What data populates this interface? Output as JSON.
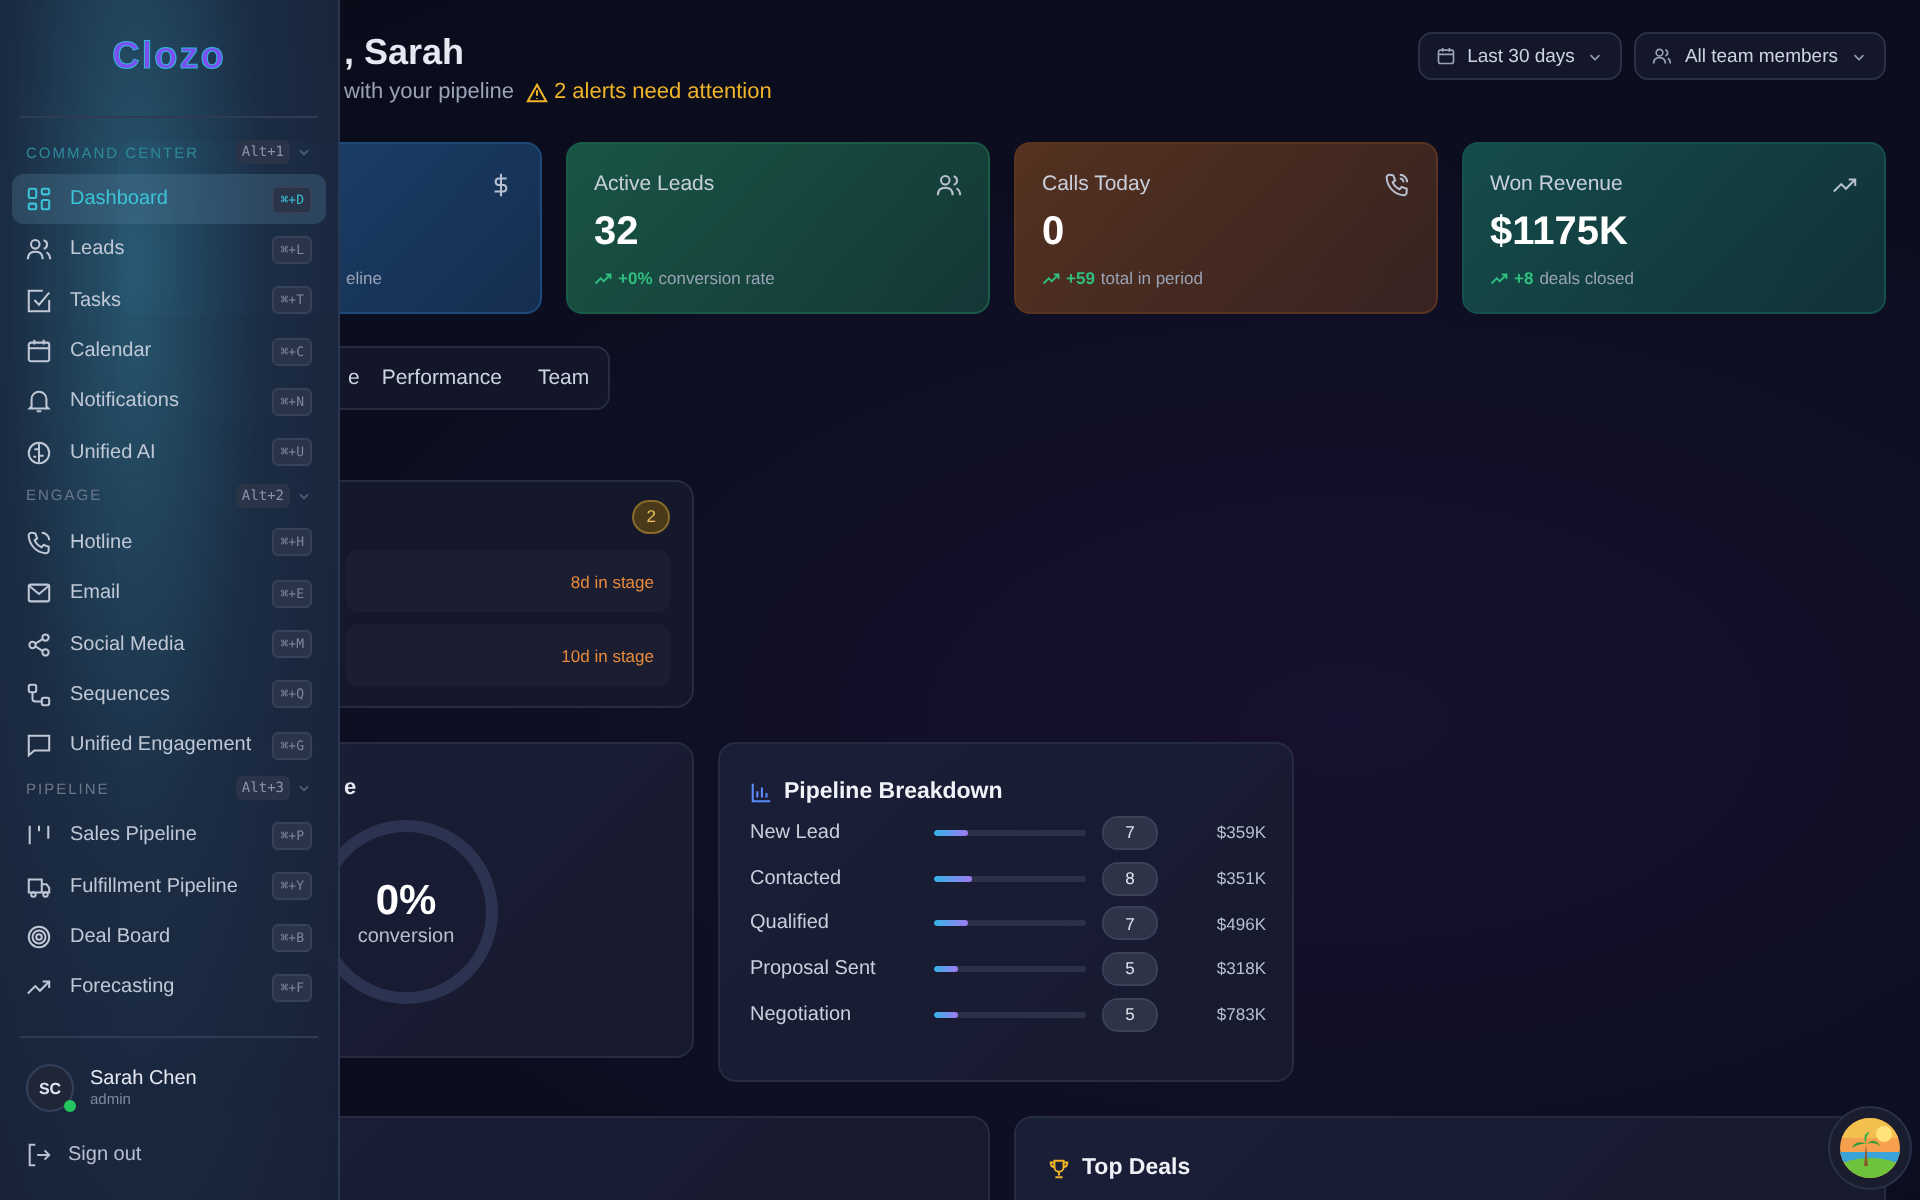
{
  "sidebar": {
    "logo": "Clozo",
    "sections": [
      {
        "title": "COMMAND CENTER",
        "shortcut": "Alt+1",
        "active": true,
        "items": [
          {
            "label": "Dashboard",
            "shortcut": "⌘+D",
            "selected": true
          },
          {
            "label": "Leads",
            "shortcut": "⌘+L",
            "selected": false
          },
          {
            "label": "Tasks",
            "shortcut": "⌘+T",
            "selected": false
          },
          {
            "label": "Calendar",
            "shortcut": "⌘+C",
            "selected": false
          },
          {
            "label": "Notifications",
            "shortcut": "⌘+N",
            "selected": false
          },
          {
            "label": "Unified AI",
            "shortcut": "⌘+U",
            "selected": false
          }
        ]
      },
      {
        "title": "ENGAGE",
        "shortcut": "Alt+2",
        "active": false,
        "items": [
          {
            "label": "Hotline",
            "shortcut": "⌘+H",
            "selected": false
          },
          {
            "label": "Email",
            "shortcut": "⌘+E",
            "selected": false
          },
          {
            "label": "Social Media",
            "shortcut": "⌘+M",
            "selected": false
          },
          {
            "label": "Sequences",
            "shortcut": "⌘+Q",
            "selected": false
          },
          {
            "label": "Unified Engagement",
            "shortcut": "⌘+G",
            "selected": false
          }
        ]
      },
      {
        "title": "PIPELINE",
        "shortcut": "Alt+3",
        "active": false,
        "items": [
          {
            "label": "Sales Pipeline",
            "shortcut": "⌘+P",
            "selected": false
          },
          {
            "label": "Fulfillment Pipeline",
            "shortcut": "⌘+Y",
            "selected": false
          },
          {
            "label": "Deal Board",
            "shortcut": "⌘+B",
            "selected": false
          },
          {
            "label": "Forecasting",
            "shortcut": "⌘+F",
            "selected": false
          }
        ]
      }
    ],
    "user": {
      "initials": "SC",
      "name": "Sarah Chen",
      "role": "admin",
      "online": true
    },
    "sign_out": "Sign out"
  },
  "header": {
    "title": ", Sarah",
    "subtitle": "with your pipeline",
    "alert": "2 alerts need attention",
    "filters": [
      "Last 30 days",
      "All team members"
    ]
  },
  "stats": [
    {
      "note": "eline",
      "color": "#1e4a7a"
    },
    {
      "title": "Active Leads",
      "value": "32",
      "delta": "+0%",
      "note": "conversion rate",
      "color": "#1a5a48"
    },
    {
      "title": "Calls Today",
      "value": "0",
      "delta": "+59",
      "note": "total in period",
      "color": "#5a3420"
    },
    {
      "title": "Won Revenue",
      "value": "$1175K",
      "delta": "+8",
      "note": "deals closed",
      "color": "#15504c"
    }
  ],
  "tabs": [
    {
      "label": "e"
    },
    {
      "label": "Performance"
    },
    {
      "label": "Team"
    }
  ],
  "alerts": {
    "count": "2",
    "rows": [
      {
        "stage_time": "8d in stage"
      },
      {
        "stage_time": "10d in stage"
      }
    ]
  },
  "conversion": {
    "title": "e",
    "value": "0%",
    "caption": "conversion",
    "level": 0
  },
  "pipeline": {
    "title": "Pipeline Breakdown",
    "rows": [
      {
        "stage": "New Lead",
        "level": 0.22,
        "count": "7",
        "value": "$359K"
      },
      {
        "stage": "Contacted",
        "level": 0.25,
        "count": "8",
        "value": "$351K"
      },
      {
        "stage": "Qualified",
        "level": 0.22,
        "count": "7",
        "value": "$496K"
      },
      {
        "stage": "Proposal Sent",
        "level": 0.16,
        "count": "5",
        "value": "$318K"
      },
      {
        "stage": "Negotiation",
        "level": 0.16,
        "count": "5",
        "value": "$783K"
      }
    ]
  },
  "top_deals": {
    "title": "Top Deals"
  }
}
